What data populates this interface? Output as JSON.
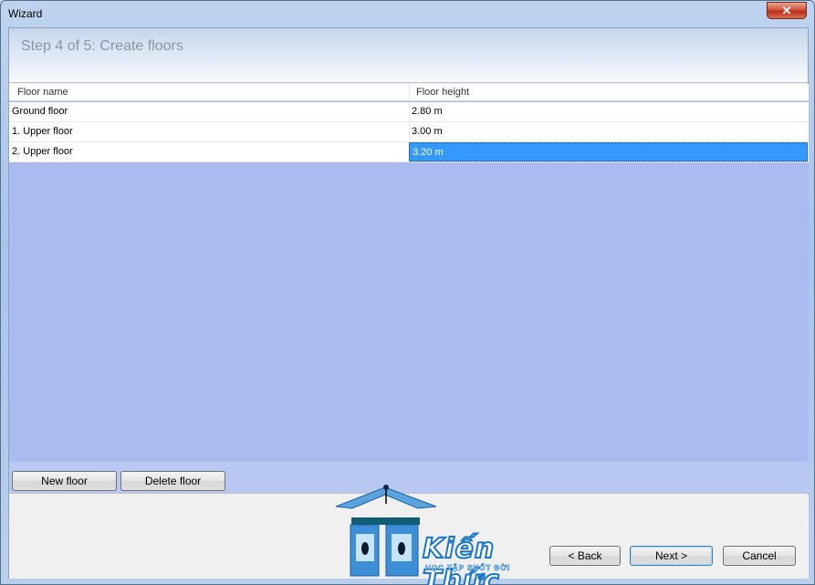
{
  "window": {
    "title": "Wizard",
    "close_glyph": "✕"
  },
  "header": {
    "step_title": "Step 4 of 5:  Create floors"
  },
  "table": {
    "columns": [
      "Floor name",
      "Floor height"
    ],
    "rows": [
      {
        "name": "Ground floor",
        "height": "2.80 m"
      },
      {
        "name": "1. Upper floor",
        "height": "3.00 m"
      },
      {
        "name": "2. Upper floor",
        "height": "3.20 m",
        "selected": true
      }
    ]
  },
  "toolbar": {
    "new_floor": "New floor",
    "delete_floor": "Delete floor"
  },
  "footer": {
    "back": "< Back",
    "next": "Next >",
    "cancel": "Cancel"
  },
  "watermark": {
    "title": "Kiến Thức",
    "subtitle": "HỌC TẬP SUỐT ĐỜI"
  },
  "colors": {
    "selection": "#3399ff",
    "grid_background": "#abbbef",
    "close_button": "#c4422a"
  }
}
